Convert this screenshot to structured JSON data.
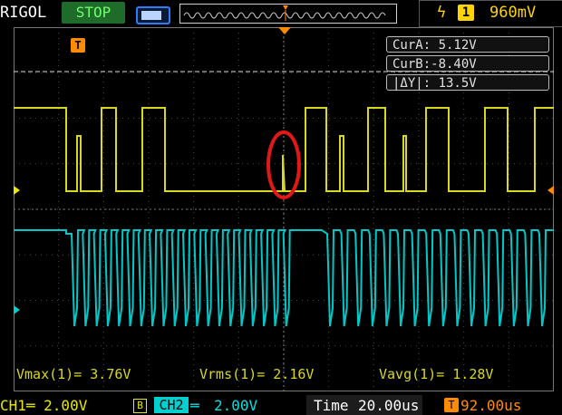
{
  "topbar": {
    "brand": "RIGOL",
    "run_state": "STOP",
    "trigger_source": "1",
    "trigger_level": "960mV",
    "trigger_edge_icon": "rising-edge-icon"
  },
  "cursors": {
    "cur_a": "CurA:  5.12V",
    "cur_b": "CurB:-8.40V",
    "delta_y": "|ΔY|:  13.5V"
  },
  "measurements": {
    "vmax": "Vmax(1)=  3.76V",
    "vrms": "Vrms(1)=  2.16V",
    "vavg": "Vavg(1)=  1.28V"
  },
  "bottombar": {
    "ch1": "CH1═  2.00V",
    "ch1_bw": "B",
    "ch2_tag": "CH2",
    "ch2_coupling": "═",
    "ch2_scale": "2.00V",
    "time_label": "Time",
    "timebase": "20.00us",
    "trigger_offset": "92.00us"
  },
  "markers": {
    "trigger_time_marker": "T"
  },
  "colors": {
    "ch1": "#d8d820",
    "ch2": "#00c8c8",
    "trigger": "#ff8c00",
    "annotation": "#e01818",
    "grid": "#5a5a5a"
  }
}
